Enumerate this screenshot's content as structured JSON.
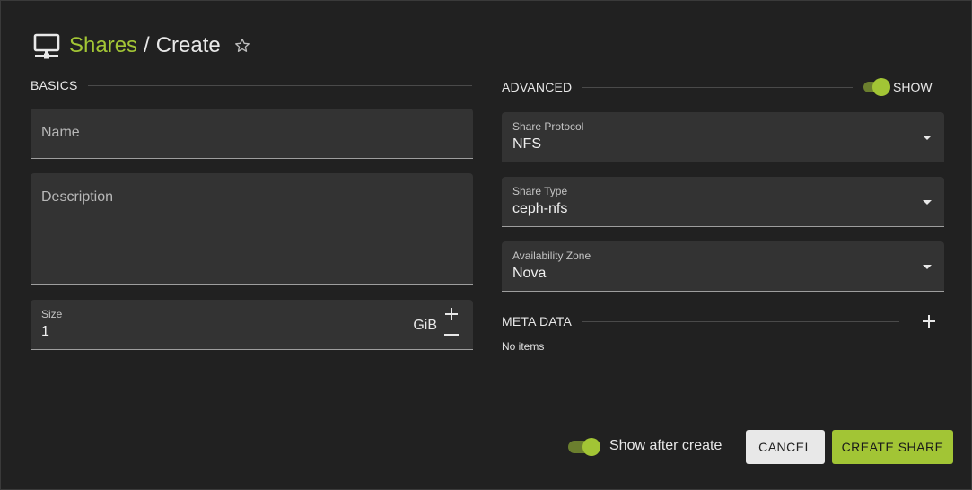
{
  "header": {
    "icon": "monitor-icon",
    "breadcrumb_link": "Shares",
    "separator": "/",
    "current": "Create",
    "favorite_icon": "star-outline-icon"
  },
  "basics": {
    "title": "BASICS",
    "name_placeholder": "Name",
    "description_placeholder": "Description",
    "size": {
      "label": "Size",
      "value": "1",
      "unit": "GiB"
    }
  },
  "advanced": {
    "title": "ADVANCED",
    "show_label": "SHOW",
    "show_enabled": true,
    "share_protocol": {
      "label": "Share Protocol",
      "value": "NFS"
    },
    "share_type": {
      "label": "Share Type",
      "value": "ceph-nfs"
    },
    "availability_zone": {
      "label": "Availability Zone",
      "value": "Nova"
    }
  },
  "meta_data": {
    "title": "META DATA",
    "empty_text": "No items"
  },
  "footer": {
    "show_after_create_label": "Show after create",
    "show_after_create_enabled": true,
    "cancel_label": "CANCEL",
    "create_label": "CREATE SHARE"
  },
  "colors": {
    "accent": "#a2c535",
    "background": "#212121",
    "field": "#333333"
  }
}
